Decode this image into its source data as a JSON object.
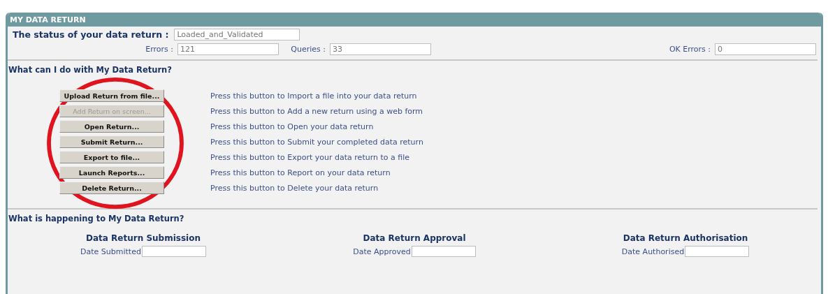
{
  "panel": {
    "title": "MY DATA RETURN"
  },
  "status": {
    "label": "The status of your data return :",
    "value": "Loaded_and_Validated"
  },
  "counts": [
    {
      "label": "Errors :",
      "value": "121"
    },
    {
      "label": "Queries :",
      "value": "33"
    },
    {
      "label": "OK Errors :",
      "value": "0"
    }
  ],
  "actions": {
    "heading": "What can I do with My Data Return?",
    "items": [
      {
        "button": "Upload Return from file...",
        "disabled": false,
        "description": "Press this button to Import a file into your data return"
      },
      {
        "button": "Add Return on screen...",
        "disabled": true,
        "description": "Press this button to Add a new return using a web form"
      },
      {
        "button": "Open Return...",
        "disabled": false,
        "description": "Press this button to Open your data return"
      },
      {
        "button": "Submit Return...",
        "disabled": false,
        "description": "Press this button to Submit your completed data return"
      },
      {
        "button": "Export to file...",
        "disabled": false,
        "description": "Press this button to Export your data return to a file"
      },
      {
        "button": "Launch Reports...",
        "disabled": false,
        "description": "Press this button to Report on your data return"
      },
      {
        "button": "Delete Return...",
        "disabled": false,
        "description": "Press this button to Delete your data return"
      }
    ]
  },
  "progress": {
    "heading": "What is happening to My Data Return?",
    "stages": [
      {
        "title": "Data Return Submission",
        "label": "Date Submitted"
      },
      {
        "title": "Data Return Approval",
        "label": "Date Approved"
      },
      {
        "title": "Data Return Authorisation",
        "label": "Date Authorised"
      }
    ]
  }
}
